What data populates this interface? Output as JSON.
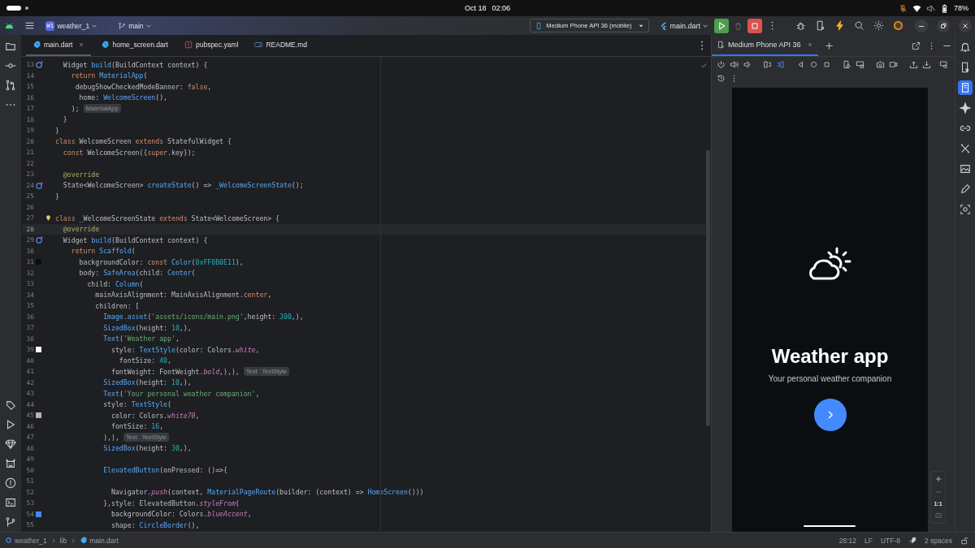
{
  "os_bar": {
    "date": "Oct 18",
    "time": "02:06",
    "battery": "78%"
  },
  "title_bar": {
    "project_badge": "W1",
    "project": "weather_1",
    "branch": "main",
    "device": "Medium Phone API 36 (mobile)",
    "run_config": "main.dart"
  },
  "editor_tabs": [
    {
      "label": "main.dart",
      "kind": "dart",
      "selected": true
    },
    {
      "label": "home_screen.dart",
      "kind": "dart",
      "selected": false
    },
    {
      "label": "pubspec.yaml",
      "kind": "yaml",
      "selected": false
    },
    {
      "label": "README.md",
      "kind": "markdown",
      "selected": false
    }
  ],
  "editor": {
    "lines": [
      {
        "n": "13",
        "current": false,
        "marker": {
          "kind": "override"
        },
        "tokens": [
          {
            "t": "  Widget ",
            "kind": "plain"
          },
          {
            "t": "build",
            "kind": "type"
          },
          {
            "t": "(BuildContext context) {",
            "kind": "plain"
          }
        ]
      },
      {
        "n": "14",
        "current": false,
        "tokens": [
          {
            "t": "    return ",
            "kind": "keyword"
          },
          {
            "t": "MaterialApp",
            "kind": "type"
          },
          {
            "t": "(",
            "kind": "plain"
          }
        ]
      },
      {
        "n": "15",
        "current": false,
        "tokens": [
          {
            "t": "     debugShowCheckedModeBanner: ",
            "kind": "plain"
          },
          {
            "t": "false",
            "kind": "keyword"
          },
          {
            "t": ",",
            "kind": "plain"
          }
        ]
      },
      {
        "n": "16",
        "current": false,
        "tokens": [
          {
            "t": "      home: ",
            "kind": "plain"
          },
          {
            "t": "WelcomeScreen",
            "kind": "type"
          },
          {
            "t": "(),",
            "kind": "plain"
          }
        ]
      },
      {
        "n": "17",
        "current": false,
        "tokens": [
          {
            "t": "    );",
            "kind": "plain"
          },
          {
            "t": "MaterialApp",
            "kind": "hint"
          }
        ]
      },
      {
        "n": "18",
        "current": false,
        "tokens": [
          {
            "t": "  }",
            "kind": "plain"
          }
        ]
      },
      {
        "n": "19",
        "current": false,
        "tokens": [
          {
            "t": "}",
            "kind": "plain"
          }
        ]
      },
      {
        "n": "20",
        "current": false,
        "tokens": [
          {
            "t": "class ",
            "kind": "keyword"
          },
          {
            "t": "WelcomeScreen ",
            "kind": "plain"
          },
          {
            "t": "extends ",
            "kind": "keyword"
          },
          {
            "t": "StatefulWidget {",
            "kind": "plain"
          }
        ]
      },
      {
        "n": "21",
        "current": false,
        "tokens": [
          {
            "t": "  const ",
            "kind": "keyword"
          },
          {
            "t": "WelcomeScreen({",
            "kind": "plain"
          },
          {
            "t": "super",
            "kind": "keyword"
          },
          {
            "t": ".key});",
            "kind": "plain"
          }
        ]
      },
      {
        "n": "22",
        "current": false
      },
      {
        "n": "23",
        "current": false,
        "tokens": [
          {
            "t": "  @override",
            "kind": "annotation"
          }
        ]
      },
      {
        "n": "24",
        "current": false,
        "marker": {
          "kind": "override"
        },
        "tokens": [
          {
            "t": "  State<WelcomeScreen> ",
            "kind": "plain"
          },
          {
            "t": "createState",
            "kind": "type"
          },
          {
            "t": "() => ",
            "kind": "plain"
          },
          {
            "t": "_WelcomeScreenState",
            "kind": "type"
          },
          {
            "t": "();",
            "kind": "plain"
          }
        ]
      },
      {
        "n": "25",
        "current": false,
        "tokens": [
          {
            "t": "}",
            "kind": "plain"
          }
        ]
      },
      {
        "n": "26",
        "current": false
      },
      {
        "n": "27",
        "current": false,
        "marker": {
          "kind": "bulb"
        },
        "tokens": [
          {
            "t": "class ",
            "kind": "keyword"
          },
          {
            "t": "_WelcomeScreenState ",
            "kind": "plain"
          },
          {
            "t": "extends ",
            "kind": "keyword"
          },
          {
            "t": "State<WelcomeScreen> {",
            "kind": "plain"
          }
        ]
      },
      {
        "n": "28",
        "current": true,
        "tokens": [
          {
            "t": "  @override",
            "kind": "annotation"
          }
        ]
      },
      {
        "n": "29",
        "current": false,
        "marker": {
          "kind": "override"
        },
        "tokens": [
          {
            "t": "  Widget ",
            "kind": "plain"
          },
          {
            "t": "build",
            "kind": "type"
          },
          {
            "t": "(BuildContext context) {",
            "kind": "plain"
          }
        ]
      },
      {
        "n": "30",
        "current": false,
        "tokens": [
          {
            "t": "    return ",
            "kind": "keyword"
          },
          {
            "t": "Scaffold",
            "kind": "type"
          },
          {
            "t": "(",
            "kind": "plain"
          }
        ]
      },
      {
        "n": "31",
        "current": false,
        "marker": {
          "kind": "swatch",
          "color": "#0b0e11"
        },
        "tokens": [
          {
            "t": "      backgroundColor: ",
            "kind": "plain"
          },
          {
            "t": "const ",
            "kind": "keyword"
          },
          {
            "t": "Color",
            "kind": "type"
          },
          {
            "t": "(",
            "kind": "plain"
          },
          {
            "t": "0xFF0B0E11",
            "kind": "number"
          },
          {
            "t": "),",
            "kind": "plain"
          }
        ]
      },
      {
        "n": "32",
        "current": false,
        "tokens": [
          {
            "t": "      body: ",
            "kind": "plain"
          },
          {
            "t": "SafeArea",
            "kind": "type"
          },
          {
            "t": "(child: ",
            "kind": "plain"
          },
          {
            "t": "Center",
            "kind": "type"
          },
          {
            "t": "(",
            "kind": "plain"
          }
        ]
      },
      {
        "n": "33",
        "current": false,
        "tokens": [
          {
            "t": "        child: ",
            "kind": "plain"
          },
          {
            "t": "Column",
            "kind": "type"
          },
          {
            "t": "(",
            "kind": "plain"
          }
        ]
      },
      {
        "n": "34",
        "current": false,
        "tokens": [
          {
            "t": "          mainAxisAlignment: MainAxisAlignment.",
            "kind": "plain"
          },
          {
            "t": "center",
            "kind": "keyword"
          },
          {
            "t": ",",
            "kind": "plain"
          }
        ]
      },
      {
        "n": "35",
        "current": false,
        "tokens": [
          {
            "t": "          children: [",
            "kind": "plain"
          }
        ]
      },
      {
        "n": "36",
        "current": false,
        "tokens": [
          {
            "t": "            Image.asset",
            "kind": "type"
          },
          {
            "t": "(",
            "kind": "plain"
          },
          {
            "t": "'assets/icons/main.png'",
            "kind": "string"
          },
          {
            "t": ",height: ",
            "kind": "plain"
          },
          {
            "t": "300",
            "kind": "number"
          },
          {
            "t": ",),",
            "kind": "plain"
          }
        ]
      },
      {
        "n": "37",
        "current": false,
        "tokens": [
          {
            "t": "            SizedBox",
            "kind": "type"
          },
          {
            "t": "(height: ",
            "kind": "plain"
          },
          {
            "t": "10",
            "kind": "number"
          },
          {
            "t": ",),",
            "kind": "plain"
          }
        ]
      },
      {
        "n": "38",
        "current": false,
        "tokens": [
          {
            "t": "            Text",
            "kind": "type"
          },
          {
            "t": "(",
            "kind": "plain"
          },
          {
            "t": "'Weather app'",
            "kind": "string"
          },
          {
            "t": ",",
            "kind": "plain"
          }
        ]
      },
      {
        "n": "39",
        "current": false,
        "marker": {
          "kind": "swatch",
          "color": "#ffffff"
        },
        "tokens": [
          {
            "t": "              style: ",
            "kind": "plain"
          },
          {
            "t": "TextStyle",
            "kind": "type"
          },
          {
            "t": "(color: Colors.",
            "kind": "plain"
          },
          {
            "t": "white",
            "kind": "italic"
          },
          {
            "t": ",",
            "kind": "plain"
          }
        ]
      },
      {
        "n": "40",
        "current": false,
        "tokens": [
          {
            "t": "                fontSize: ",
            "kind": "plain"
          },
          {
            "t": "40",
            "kind": "number"
          },
          {
            "t": ",",
            "kind": "plain"
          }
        ]
      },
      {
        "n": "41",
        "current": false,
        "tokens": [
          {
            "t": "              fontWeight: FontWeight.",
            "kind": "plain"
          },
          {
            "t": "bold",
            "kind": "italic"
          },
          {
            "t": ",),),",
            "kind": "plain"
          },
          {
            "t": "Text",
            "kind": "hint"
          },
          {
            "t": "TextStyle",
            "kind": "hint"
          }
        ]
      },
      {
        "n": "42",
        "current": false,
        "tokens": [
          {
            "t": "            SizedBox",
            "kind": "type"
          },
          {
            "t": "(height: ",
            "kind": "plain"
          },
          {
            "t": "10",
            "kind": "number"
          },
          {
            "t": ",),",
            "kind": "plain"
          }
        ]
      },
      {
        "n": "43",
        "current": false,
        "tokens": [
          {
            "t": "            Text",
            "kind": "type"
          },
          {
            "t": "(",
            "kind": "plain"
          },
          {
            "t": "'Your personal weather companion'",
            "kind": "string"
          },
          {
            "t": ",",
            "kind": "plain"
          }
        ]
      },
      {
        "n": "44",
        "current": false,
        "tokens": [
          {
            "t": "            style: ",
            "kind": "plain"
          },
          {
            "t": "TextStyle",
            "kind": "type"
          },
          {
            "t": "(",
            "kind": "plain"
          }
        ]
      },
      {
        "n": "45",
        "current": false,
        "marker": {
          "kind": "swatch",
          "color": "#b3b3b3"
        },
        "tokens": [
          {
            "t": "              color: Colors.",
            "kind": "plain"
          },
          {
            "t": "white70",
            "kind": "italic"
          },
          {
            "t": ",",
            "kind": "plain"
          }
        ]
      },
      {
        "n": "46",
        "current": false,
        "tokens": [
          {
            "t": "              fontSize: ",
            "kind": "plain"
          },
          {
            "t": "16",
            "kind": "number"
          },
          {
            "t": ",",
            "kind": "plain"
          }
        ]
      },
      {
        "n": "47",
        "current": false,
        "tokens": [
          {
            "t": "            ),),",
            "kind": "plain"
          },
          {
            "t": "Text",
            "kind": "hint"
          },
          {
            "t": "TextStyle",
            "kind": "hint"
          }
        ]
      },
      {
        "n": "48",
        "current": false,
        "tokens": [
          {
            "t": "            SizedBox",
            "kind": "type"
          },
          {
            "t": "(height: ",
            "kind": "plain"
          },
          {
            "t": "30",
            "kind": "number"
          },
          {
            "t": ",),",
            "kind": "plain"
          }
        ]
      },
      {
        "n": "49",
        "current": false
      },
      {
        "n": "50",
        "current": false,
        "tokens": [
          {
            "t": "            ElevatedButton",
            "kind": "type"
          },
          {
            "t": "(onPressed: ()=>{",
            "kind": "plain"
          }
        ]
      },
      {
        "n": "51",
        "current": false
      },
      {
        "n": "52",
        "current": false,
        "tokens": [
          {
            "t": "              Navigator.",
            "kind": "plain"
          },
          {
            "t": "push",
            "kind": "italic"
          },
          {
            "t": "(context, ",
            "kind": "plain"
          },
          {
            "t": "MaterialPageRoute",
            "kind": "type"
          },
          {
            "t": "(builder: (context) => ",
            "kind": "plain"
          },
          {
            "t": "HomeScreen",
            "kind": "type"
          },
          {
            "t": "()))",
            "kind": "plain"
          }
        ]
      },
      {
        "n": "53",
        "current": false,
        "tokens": [
          {
            "t": "            },style: ElevatedButton.",
            "kind": "plain"
          },
          {
            "t": "styleFrom",
            "kind": "italic"
          },
          {
            "t": "(",
            "kind": "plain"
          }
        ]
      },
      {
        "n": "54",
        "current": false,
        "marker": {
          "kind": "swatch",
          "color": "#448aff"
        },
        "tokens": [
          {
            "t": "              backgroundColor: Colors.",
            "kind": "plain"
          },
          {
            "t": "blueAccent",
            "kind": "italic"
          },
          {
            "t": ",",
            "kind": "plain"
          }
        ]
      },
      {
        "n": "55",
        "current": false,
        "tokens": [
          {
            "t": "              shape: ",
            "kind": "plain"
          },
          {
            "t": "CircleBorder",
            "kind": "type"
          },
          {
            "t": "(),",
            "kind": "plain"
          }
        ]
      }
    ]
  },
  "emulator": {
    "tab": "Medium Phone API 36",
    "app": {
      "title": "Weather app",
      "subtitle": "Your personal weather companion"
    },
    "zoom_reset": "1:1"
  },
  "breadcrumb": [
    {
      "label": "weather_1",
      "kind": "project"
    },
    {
      "label": "lib",
      "kind": "folder"
    },
    {
      "label": "main.dart",
      "kind": "dart"
    }
  ],
  "status": {
    "position": "28:12",
    "line_separator": "LF",
    "encoding": "UTF-8",
    "indent": "2 spaces"
  }
}
